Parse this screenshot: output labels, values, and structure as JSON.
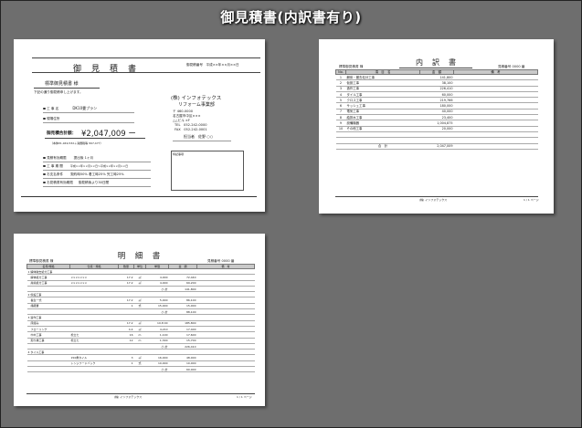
{
  "title": "御見積書(内訳書有り)",
  "estimate": {
    "heading": "御　見　積　書",
    "number_date": "御見積番号　平成××年××月××日",
    "client": "標準御見積書 様",
    "intro": "下記の通り御見積申し上げます。",
    "work_name_label": "工 事 名",
    "work_name": "DK10畳プラン",
    "site_label": "現場住所",
    "total_label": "御見積合計額：",
    "total": "¥2,047,009 ー",
    "tax_line": "（本体¥1,949,532＋消費税等 ¥97,477）",
    "company": "(株) インフォテックス",
    "company_sub": "リフォーム事業部",
    "address1": "〒 460-0000",
    "address2": "名古屋市中区×××",
    "address3": "△△ビル ×F",
    "tel": "TEL　052-242-0000",
    "fax": "FAX　052-242-0001",
    "staff": "担当者　佐野 ○○",
    "conditions": [
      {
        "label": "見積有効期限",
        "value": "提出後 1ヶ月"
      },
      {
        "label": "工 事 期 間",
        "value": "平成××年××月××日〜平成××年××月××日"
      },
      {
        "label": "お支払条件",
        "value": "契約時50% 着工時25% 完工時25%"
      },
      {
        "label": "お見積書有効期限",
        "value": "御見積後より30日間"
      }
    ],
    "remarks_label": "特記事項"
  },
  "breakdown": {
    "heading": "内　訳　書",
    "client": "標準御見積書 様",
    "number": "見積番号 0000 番",
    "headers": [
      "No.",
      "項　目　名",
      "金　額",
      "備　考"
    ],
    "rows": [
      [
        "1",
        "解体・撤去処分工事",
        "141,800",
        ""
      ],
      [
        "2",
        "仮設工事",
        "38,100",
        ""
      ],
      [
        "3",
        "造作工事",
        "226,410",
        ""
      ],
      [
        "4",
        "タイル工事",
        "60,000",
        ""
      ],
      [
        "5",
        "クロス工事",
        "219,766",
        ""
      ],
      [
        "6",
        "サッシュ工事",
        "180,000",
        ""
      ],
      [
        "7",
        "電気工事",
        "40,000",
        ""
      ],
      [
        "8",
        "給排水工事",
        "23,400",
        ""
      ],
      [
        "9",
        "設備機器",
        "1,004,875",
        ""
      ],
      [
        "10",
        "その他工事",
        "20,000",
        ""
      ]
    ],
    "total_label": "合　計",
    "total": "2,047,009",
    "footer": "(株) インフォテックス",
    "page": "1 / 1 ページ"
  },
  "detail": {
    "heading": "明　細　書",
    "client": "標準御見積書 様",
    "number": "見積番号 0000 番",
    "headers": [
      "名称/規格",
      "仕様・規格",
      "数量",
      "単位",
      "単価",
      "金　額",
      "備　考"
    ],
    "rows": [
      [
        "1 解体撤去処分工事",
        "",
        "",
        "",
        "",
        "",
        ""
      ],
      [
        "　解体処分工事",
        "×××××××",
        "17.2",
        "㎡",
        "4,000",
        "72,440",
        ""
      ],
      [
        "　産廃処分工事",
        "×××××××",
        "17.2",
        "㎡",
        "4,000",
        "69,200",
        ""
      ],
      [
        "",
        "",
        "",
        "",
        "小 計",
        "141,800",
        ""
      ],
      [
        "2 仮設工事",
        "",
        "",
        "",
        "",
        "",
        ""
      ],
      [
        "　養生一式",
        "",
        "17.2",
        "㎡",
        "5,000",
        "86,100",
        ""
      ],
      [
        "　諸経費",
        "",
        "1",
        "式",
        "15,000",
        "15,000",
        ""
      ],
      [
        "",
        "",
        "",
        "",
        "小 計",
        "88,100",
        ""
      ],
      [
        "3 造作工事",
        "",
        "",
        "",
        "",
        "",
        ""
      ],
      [
        "　床組み",
        "",
        "17.2",
        "㎡",
        "10,8 00",
        "185,800",
        ""
      ],
      [
        "　フローリング",
        "",
        "4.4",
        "㎡",
        "4,210",
        "17,400",
        ""
      ],
      [
        "　巾木工事",
        "松立た",
        "16",
        "m",
        "1,100",
        "17,600",
        ""
      ],
      [
        "　廻り縁工事",
        "松立た",
        "12",
        "m",
        "1,300",
        "15,700",
        ""
      ],
      [
        "",
        "",
        "",
        "",
        "小 計",
        "226,410",
        ""
      ],
      [
        "4 タイル工事",
        "",
        "",
        "",
        "",
        "",
        ""
      ],
      [
        "",
        "150角タイル",
        "3",
        "㎡",
        "16,000",
        "48,000",
        ""
      ],
      [
        "",
        "レンジフードバック",
        "1",
        "式",
        "10,000",
        "10,000",
        ""
      ],
      [
        "",
        "",
        "",
        "",
        "小 計",
        "60,000",
        ""
      ]
    ],
    "footer": "(株) インフォテックス",
    "page": "1 / 1 ページ"
  }
}
